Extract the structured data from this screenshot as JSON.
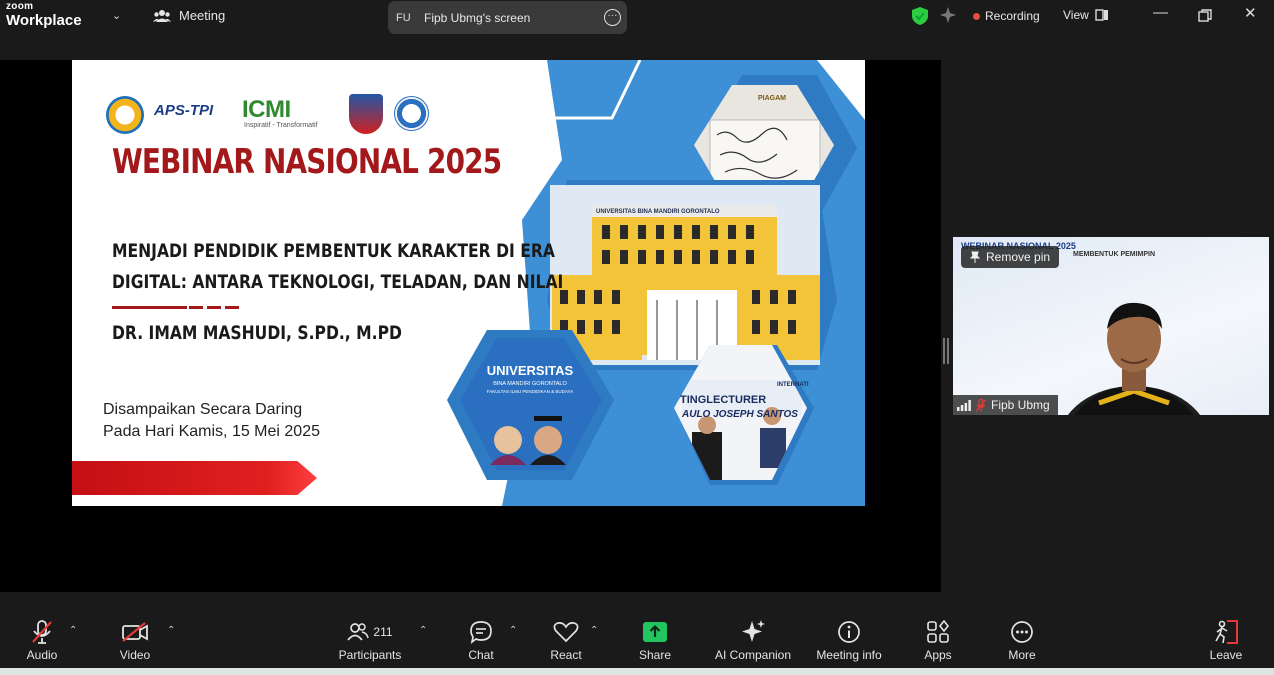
{
  "app": {
    "brand_top": "zoom",
    "brand_name": "Workplace",
    "meeting_label": "Meeting"
  },
  "screen_share": {
    "initials": "FU",
    "label": "Fipb Ubmg's screen"
  },
  "status": {
    "recording": "Recording",
    "view": "View"
  },
  "slide": {
    "logos": {
      "aps": "APS-TPI",
      "icmi": "ICMI",
      "icmi_sub": "Inspiratif - Transformatif"
    },
    "title": "WEBINAR NASIONAL 2025",
    "topic_line1": "MENJADI PENDIDIK PEMBENTUK KARAKTER DI ERA",
    "topic_line2": "DIGITAL: ANTARA TEKNOLOGI, TELADAN, DAN NILAI",
    "speaker": "DR. IMAM MASHUDI, S.PD., M.PD",
    "delivery_line1": "Disampaikan Secara Daring",
    "delivery_line2": "Pada Hari Kamis, 15 Mei 2025",
    "photo_certificate_label": "PIAGAM",
    "photo_building_label": "UNIVERSITAS BINA MANDIRI GORONTALO",
    "univ_name": "UNIVERSITAS",
    "univ_sub1": "BINA MANDIRI GORONTALO",
    "univ_sub2": "FAKULTAS ILMU PENDIDIKAN & BUDAYA",
    "lecturer_banner": "TINGLECTURER",
    "lecturer_name": "AULO JOSEPH SANTOS",
    "lecturer_top": "INTERNATI"
  },
  "participant_tile": {
    "remove_pin": "Remove pin",
    "name": "Fipb Ubmg",
    "slide_title": "WEBINAR NASIONAL 2025",
    "slide_sub": "MEMBENTUK PEMIMPIN"
  },
  "toolbar": {
    "audio": "Audio",
    "video": "Video",
    "participants": "Participants",
    "participant_count": "211",
    "chat": "Chat",
    "react": "React",
    "share": "Share",
    "ai_companion": "AI Companion",
    "meeting_info": "Meeting info",
    "apps": "Apps",
    "more": "More",
    "leave": "Leave"
  },
  "colors": {
    "share_green": "#22c55e",
    "shield_green": "#2ecc40",
    "recording_red": "#e74c3c",
    "leave_red": "#e53935",
    "slide_red": "#a3191b",
    "slide_blue": "#3d8fd6"
  }
}
